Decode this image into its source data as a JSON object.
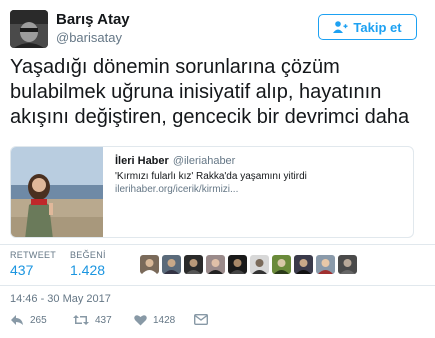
{
  "author": {
    "name": "Barış Atay",
    "handle": "@barisatay"
  },
  "follow_button": {
    "label": "Takip et",
    "icon": "follow-person-icon",
    "color": "#1da1f2"
  },
  "tweet": {
    "line1": "Yaşadığı dönemin sorunlarına çözüm",
    "line2": "bulabilmek uğruna inisiyatif alıp, hayatının",
    "line3": "akışını değiştiren, gencecik bir devrimci daha"
  },
  "card": {
    "name": "İleri Haber",
    "handle": "@ileriahaber",
    "title": "'Kırmızı fularlı kız' Rakka'da yaşamını yitirdi",
    "url": "ilerihaber.org/icerik/kirmizi..."
  },
  "stats": {
    "retweet_label": "RETWEET",
    "retweet_value": "437",
    "like_label": "BEĞENİ",
    "like_value": "1.428",
    "value_color": "#1b95e0"
  },
  "likers": [
    {
      "icon": "avatar"
    },
    {
      "icon": "avatar"
    },
    {
      "icon": "avatar"
    },
    {
      "icon": "avatar"
    },
    {
      "icon": "avatar"
    },
    {
      "icon": "avatar"
    },
    {
      "icon": "avatar"
    },
    {
      "icon": "avatar"
    },
    {
      "icon": "avatar"
    },
    {
      "icon": "avatar"
    }
  ],
  "timestamp": "14:46 - 30 May 2017",
  "actions": {
    "reply_count": "265",
    "retweet_count": "437",
    "like_count": "1428"
  }
}
